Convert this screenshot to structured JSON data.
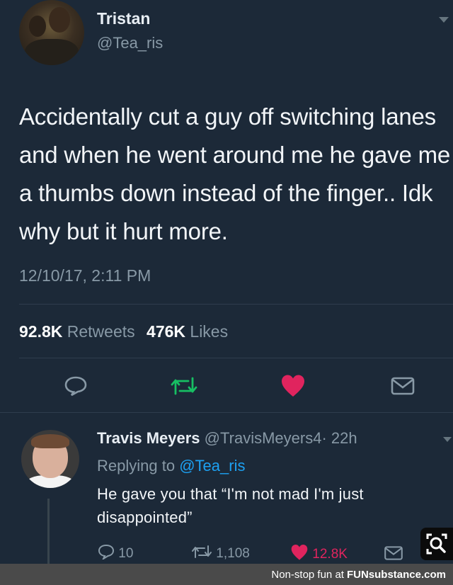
{
  "tweet": {
    "author_name": "Tristan",
    "author_handle": "@Tea_ris",
    "text": "Accidentally cut a guy off switching lanes and when he went around me he gave me a thumbs down instead of the finger.. Idk why but it hurt more.",
    "timestamp": "12/10/17, 2:11 PM",
    "retweet_count": "92.8K",
    "retweet_label": "Retweets",
    "like_count": "476K",
    "like_label": "Likes"
  },
  "reply": {
    "author_name": "Travis Meyers",
    "author_handle": "@TravisMeyers4",
    "time": "· 22h",
    "replying_prefix": "Replying to",
    "replying_to": "@Tea_ris",
    "text": "He gave you that “I'm not mad I'm just disappointed”",
    "reply_count": "10",
    "retweet_count": "1,108",
    "like_count": "12.8K"
  },
  "footer": {
    "tagline": "Non-stop fun at",
    "brand": "FUNsubstance.com"
  },
  "colors": {
    "background": "#1c2938",
    "secondary_text": "#8899a6",
    "retweet_green": "#17bf63",
    "like_red": "#e0245e",
    "link_blue": "#1da1f2"
  },
  "icons": {
    "reply": "speech-bubble",
    "retweet": "retweet-arrows",
    "like": "heart",
    "message": "envelope",
    "more": "chevron-down",
    "lens": "magnifier"
  }
}
